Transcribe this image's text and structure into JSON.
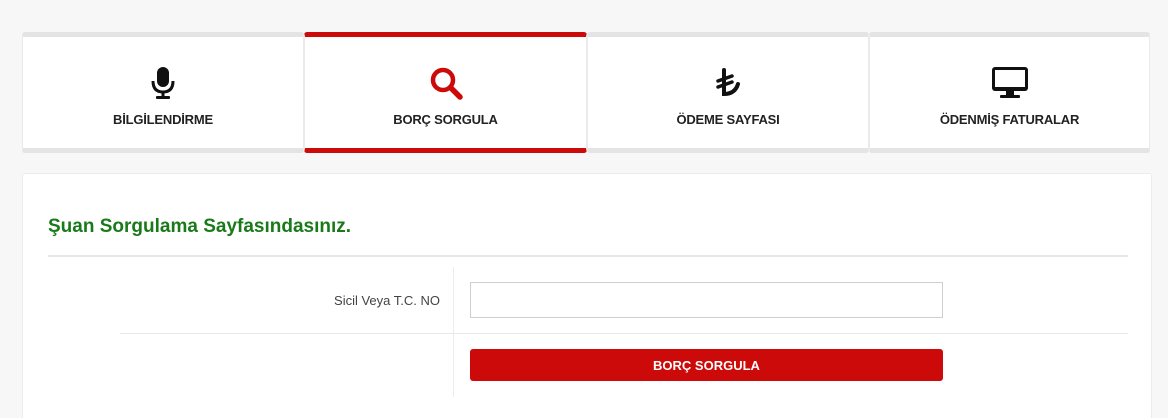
{
  "tabs": [
    {
      "label": "BİLGİLENDİRME",
      "icon": "microphone-icon",
      "active": false
    },
    {
      "label": "BORÇ SORGULA",
      "icon": "search-icon",
      "active": true
    },
    {
      "label": "ÖDEME SAYFASI",
      "icon": "turkish-lira-icon",
      "active": false
    },
    {
      "label": "ÖDENMİŞ FATURALAR",
      "icon": "monitor-icon",
      "active": false
    }
  ],
  "panel": {
    "title": "Şuan Sorgulama Sayfasındasınız.",
    "field_label": "Sicil Veya T.C. NO",
    "field_value": "",
    "field_placeholder": "",
    "submit_label": "BORÇ SORGULA"
  },
  "colors": {
    "accent": "#cc0a0a",
    "title_green": "#1a7a1a",
    "tab_border": "#e4e4e4"
  }
}
